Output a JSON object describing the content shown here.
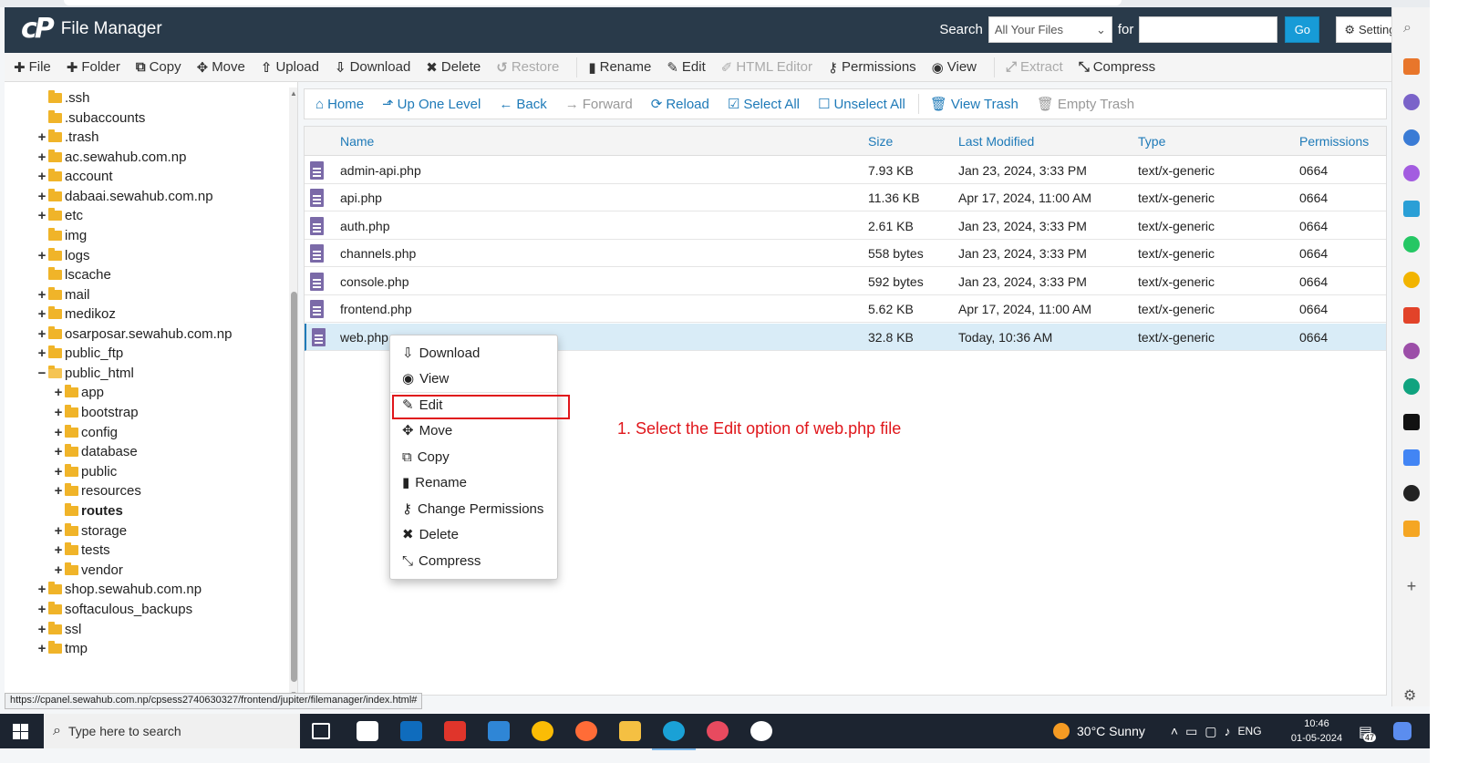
{
  "header": {
    "app_title": "File Manager",
    "search_label": "Search",
    "search_scope": "All Your Files",
    "for_label": "for",
    "search_value": "",
    "go_label": "Go",
    "settings_label": "Settings"
  },
  "toolbar": {
    "file": "File",
    "folder": "Folder",
    "copy": "Copy",
    "move": "Move",
    "upload": "Upload",
    "download": "Download",
    "delete": "Delete",
    "restore": "Restore",
    "rename": "Rename",
    "edit": "Edit",
    "html_editor": "HTML Editor",
    "permissions": "Permissions",
    "view": "View",
    "extract": "Extract",
    "compress": "Compress"
  },
  "tree": {
    "items": [
      {
        "label": ".ssh",
        "toggle": ""
      },
      {
        "label": ".subaccounts",
        "toggle": ""
      },
      {
        "label": ".trash",
        "toggle": "+"
      },
      {
        "label": "ac.sewahub.com.np",
        "toggle": "+"
      },
      {
        "label": "account",
        "toggle": "+"
      },
      {
        "label": "dabaai.sewahub.com.np",
        "toggle": "+"
      },
      {
        "label": "etc",
        "toggle": "+"
      },
      {
        "label": "img",
        "toggle": ""
      },
      {
        "label": "logs",
        "toggle": "+"
      },
      {
        "label": "lscache",
        "toggle": ""
      },
      {
        "label": "mail",
        "toggle": "+"
      },
      {
        "label": "medikoz",
        "toggle": "+"
      },
      {
        "label": "osarposar.sewahub.com.np",
        "toggle": "+"
      },
      {
        "label": "public_ftp",
        "toggle": "+"
      },
      {
        "label": "public_html",
        "toggle": "−"
      },
      {
        "label": "app",
        "toggle": "+"
      },
      {
        "label": "bootstrap",
        "toggle": "+"
      },
      {
        "label": "config",
        "toggle": "+"
      },
      {
        "label": "database",
        "toggle": "+"
      },
      {
        "label": "public",
        "toggle": "+"
      },
      {
        "label": "resources",
        "toggle": "+"
      },
      {
        "label": "routes",
        "toggle": ""
      },
      {
        "label": "storage",
        "toggle": "+"
      },
      {
        "label": "tests",
        "toggle": "+"
      },
      {
        "label": "vendor",
        "toggle": "+"
      },
      {
        "label": "shop.sewahub.com.np",
        "toggle": "+"
      },
      {
        "label": "softaculous_backups",
        "toggle": "+"
      },
      {
        "label": "ssl",
        "toggle": "+"
      },
      {
        "label": "tmp",
        "toggle": "+"
      }
    ]
  },
  "nav": {
    "home": "Home",
    "up": "Up One Level",
    "back": "Back",
    "forward": "Forward",
    "reload": "Reload",
    "select_all": "Select All",
    "unselect_all": "Unselect All",
    "view_trash": "View Trash",
    "empty_trash": "Empty Trash"
  },
  "table": {
    "headers": {
      "name": "Name",
      "size": "Size",
      "modified": "Last Modified",
      "type": "Type",
      "permissions": "Permissions"
    },
    "rows": [
      {
        "name": "admin-api.php",
        "size": "7.93 KB",
        "modified": "Jan 23, 2024, 3:33 PM",
        "type": "text/x-generic",
        "perm": "0664"
      },
      {
        "name": "api.php",
        "size": "11.36 KB",
        "modified": "Apr 17, 2024, 11:00 AM",
        "type": "text/x-generic",
        "perm": "0664"
      },
      {
        "name": "auth.php",
        "size": "2.61 KB",
        "modified": "Jan 23, 2024, 3:33 PM",
        "type": "text/x-generic",
        "perm": "0664"
      },
      {
        "name": "channels.php",
        "size": "558 bytes",
        "modified": "Jan 23, 2024, 3:33 PM",
        "type": "text/x-generic",
        "perm": "0664"
      },
      {
        "name": "console.php",
        "size": "592 bytes",
        "modified": "Jan 23, 2024, 3:33 PM",
        "type": "text/x-generic",
        "perm": "0664"
      },
      {
        "name": "frontend.php",
        "size": "5.62 KB",
        "modified": "Apr 17, 2024, 11:00 AM",
        "type": "text/x-generic",
        "perm": "0664"
      },
      {
        "name": "web.php",
        "size": "32.8 KB",
        "modified": "Today, 10:36 AM",
        "type": "text/x-generic",
        "perm": "0664"
      }
    ]
  },
  "context_menu": {
    "items": [
      "Download",
      "View",
      "Edit",
      "Move",
      "Copy",
      "Rename",
      "Change Permissions",
      "Delete",
      "Compress"
    ]
  },
  "annotation": "1. Select the Edit option of web.php file",
  "status_url": "https://cpanel.sewahub.com.np/cpsess2740630327/frontend/jupiter/filemanager/index.html#",
  "taskbar": {
    "search_placeholder": "Type here to search",
    "weather": "30°C  Sunny",
    "lang": "ENG",
    "time": "10:46",
    "date": "01-05-2024",
    "notif_count": "47"
  },
  "colors": {
    "header_bg": "#293a4a",
    "link_blue": "#1e7ab8",
    "go_blue": "#179bd7",
    "highlight_red": "#e0161b",
    "folder_yellow": "#f0b429",
    "selected_row": "#d9ecf7"
  }
}
